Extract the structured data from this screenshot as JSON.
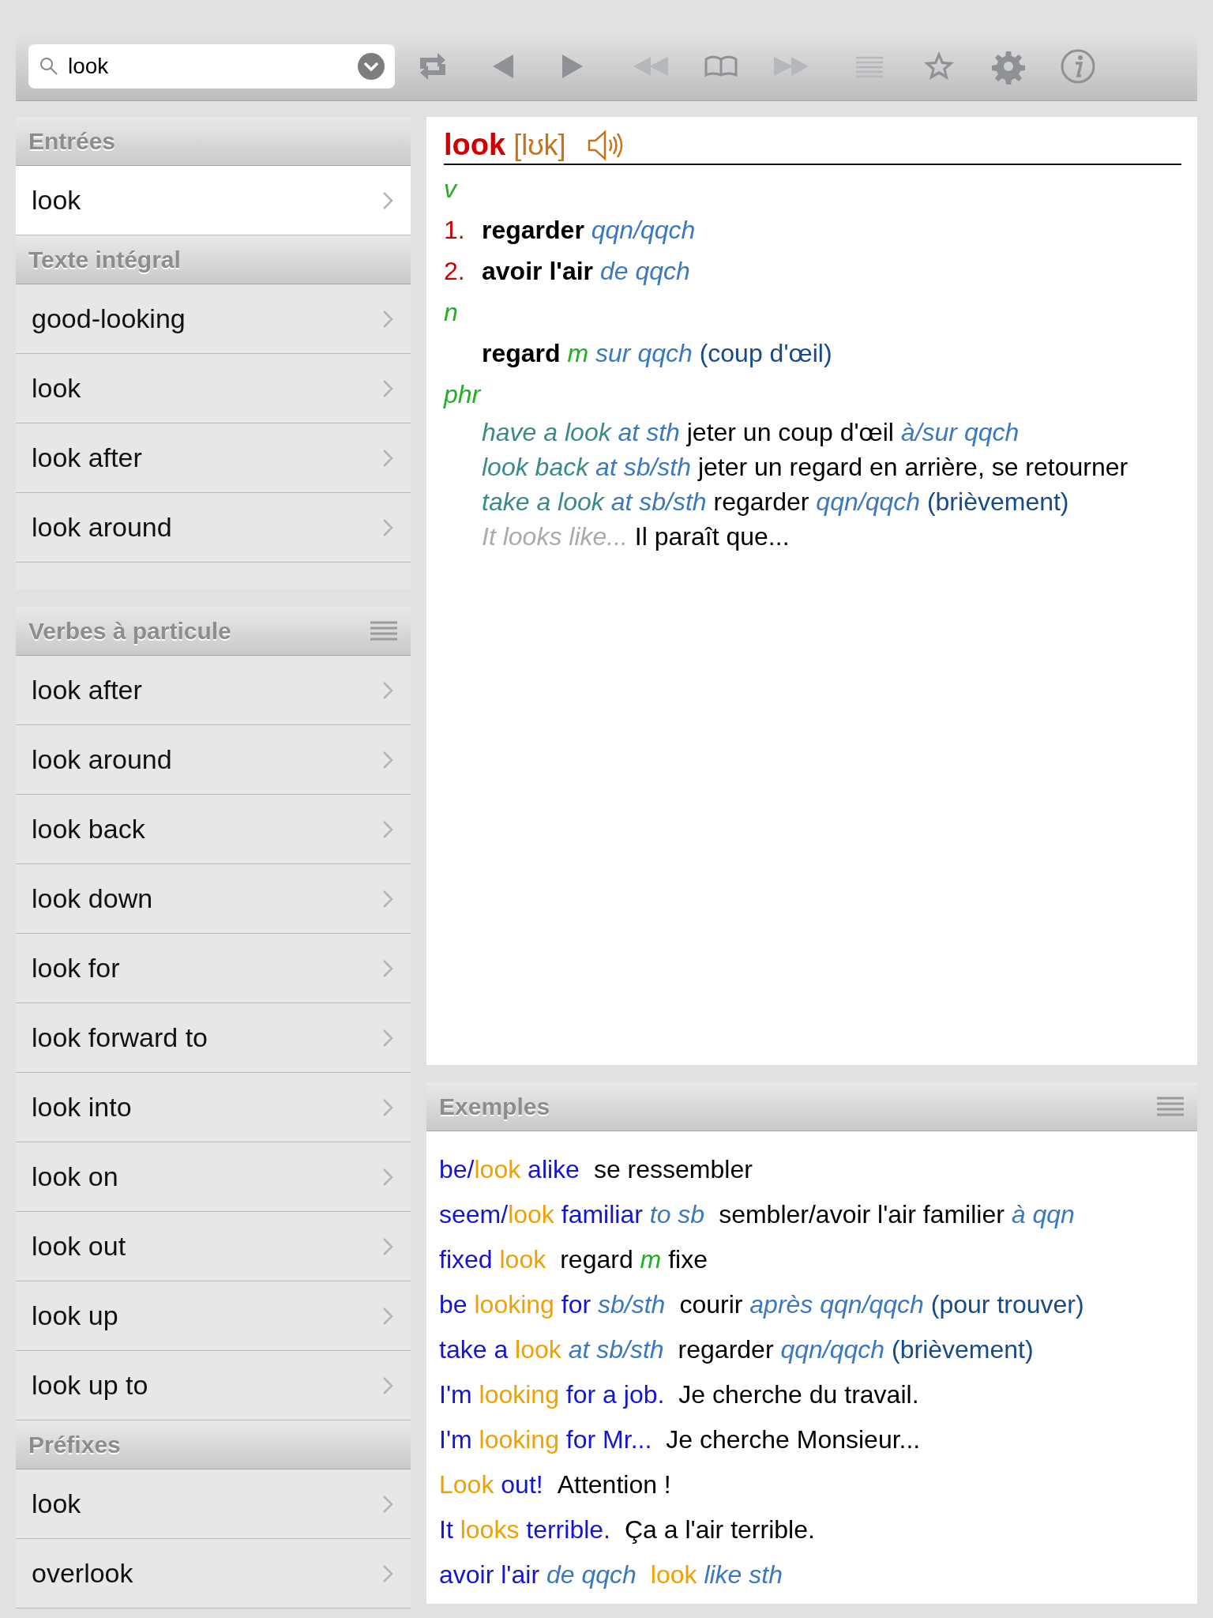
{
  "toolbar": {
    "search": {
      "value": "look"
    },
    "buttons": [
      {
        "kind": "sync",
        "disabled": false
      },
      {
        "kind": "back",
        "disabled": false
      },
      {
        "kind": "forward",
        "disabled": false
      },
      {
        "kind": "history-back",
        "disabled": true
      },
      {
        "kind": "book",
        "disabled": false
      },
      {
        "kind": "history-forward",
        "disabled": true
      },
      {
        "kind": "list",
        "disabled": true
      },
      {
        "kind": "star",
        "disabled": false
      },
      {
        "kind": "gear",
        "disabled": false
      },
      {
        "kind": "info",
        "disabled": false
      }
    ]
  },
  "sidebar": {
    "sections": [
      {
        "title": "Entrées",
        "has_menu": false,
        "clipped": false,
        "items": [
          {
            "label": "look",
            "selected": true
          }
        ]
      },
      {
        "title": "Texte intégral",
        "has_menu": false,
        "clipped": true,
        "items": [
          {
            "label": "good-looking",
            "selected": false
          },
          {
            "label": "look",
            "selected": false
          },
          {
            "label": "look after",
            "selected": false
          },
          {
            "label": "look around",
            "selected": false
          }
        ]
      },
      {
        "title": "Verbes à particule",
        "has_menu": true,
        "clipped": false,
        "items": [
          {
            "label": "look after",
            "selected": false
          },
          {
            "label": "look around",
            "selected": false
          },
          {
            "label": "look back",
            "selected": false
          },
          {
            "label": "look down",
            "selected": false
          },
          {
            "label": "look for",
            "selected": false
          },
          {
            "label": "look forward to",
            "selected": false
          },
          {
            "label": "look into",
            "selected": false
          },
          {
            "label": "look on",
            "selected": false
          },
          {
            "label": "look out",
            "selected": false
          },
          {
            "label": "look up",
            "selected": false
          },
          {
            "label": "look up to",
            "selected": false
          }
        ]
      },
      {
        "title": "Préfixes",
        "has_menu": false,
        "clipped": false,
        "items": [
          {
            "label": "look",
            "selected": false
          },
          {
            "label": "overlook",
            "selected": false
          }
        ]
      }
    ]
  },
  "entry": {
    "headword": "look",
    "phonetic": "[lʊk]",
    "lines": [
      {
        "kind": "pos",
        "text": "v"
      },
      {
        "kind": "sense",
        "num": "1.",
        "segs": [
          {
            "kind": "bold",
            "t": "regarder "
          },
          {
            "kind": "ital",
            "t": "qqn/qqch"
          }
        ]
      },
      {
        "kind": "sense",
        "num": "2.",
        "segs": [
          {
            "kind": "bold",
            "t": "avoir l'air "
          },
          {
            "kind": "ital",
            "t": "de qqch"
          }
        ]
      },
      {
        "kind": "pos",
        "text": "n"
      },
      {
        "kind": "sense",
        "segs": [
          {
            "kind": "bold",
            "t": "regard "
          },
          {
            "kind": "green",
            "t": "m "
          },
          {
            "kind": "ital",
            "t": "sur qqch "
          },
          {
            "kind": "gloss",
            "t": "(coup d'œil)"
          }
        ]
      },
      {
        "kind": "pos",
        "text": "phr"
      },
      {
        "kind": "phrase",
        "segs": [
          {
            "kind": "phrase",
            "t": "have a look "
          },
          {
            "kind": "ital",
            "t": "at sth "
          },
          {
            "kind": "plain",
            "t": "jeter un coup d'œil "
          },
          {
            "kind": "ital",
            "t": "à/sur qqch"
          }
        ]
      },
      {
        "kind": "phrase",
        "segs": [
          {
            "kind": "phrase",
            "t": "look back "
          },
          {
            "kind": "ital",
            "t": "at sb/sth "
          },
          {
            "kind": "plain",
            "t": "jeter un regard en arrière, se retourner"
          }
        ]
      },
      {
        "kind": "phrase",
        "segs": [
          {
            "kind": "phrase",
            "t": "take a look "
          },
          {
            "kind": "ital",
            "t": "at sb/sth "
          },
          {
            "kind": "plain",
            "t": "regarder "
          },
          {
            "kind": "ital",
            "t": "qqn/qqch "
          },
          {
            "kind": "gloss",
            "t": "(brièvement)"
          }
        ]
      },
      {
        "kind": "phrase",
        "segs": [
          {
            "kind": "gray",
            "t": "It looks like... "
          },
          {
            "kind": "plain",
            "t": "Il paraît que..."
          }
        ]
      }
    ]
  },
  "examples": {
    "title": "Exemples",
    "has_menu": true,
    "items": [
      {
        "en": [
          {
            "kind": "en",
            "t": "be/"
          },
          {
            "kind": "key",
            "t": "look"
          },
          {
            "kind": "en",
            "t": " alike"
          }
        ],
        "fr": [
          {
            "kind": "plain",
            "t": "se ressembler"
          }
        ]
      },
      {
        "en": [
          {
            "kind": "en",
            "t": "seem/"
          },
          {
            "kind": "key",
            "t": "look"
          },
          {
            "kind": "en",
            "t": " familiar "
          },
          {
            "kind": "ital",
            "t": "to sb"
          }
        ],
        "fr": [
          {
            "kind": "plain",
            "t": "sembler/avoir l'air familier "
          },
          {
            "kind": "ital",
            "t": "à qqn"
          }
        ]
      },
      {
        "en": [
          {
            "kind": "en",
            "t": "fixed "
          },
          {
            "kind": "key",
            "t": "look"
          }
        ],
        "fr": [
          {
            "kind": "plain",
            "t": "regard "
          },
          {
            "kind": "green",
            "t": "m "
          },
          {
            "kind": "plain",
            "t": "fixe"
          }
        ]
      },
      {
        "en": [
          {
            "kind": "en",
            "t": "be "
          },
          {
            "kind": "key",
            "t": "looking"
          },
          {
            "kind": "en",
            "t": " for "
          },
          {
            "kind": "ital",
            "t": "sb/sth"
          }
        ],
        "fr": [
          {
            "kind": "plain",
            "t": "courir "
          },
          {
            "kind": "ital",
            "t": "après qqn/qqch "
          },
          {
            "kind": "gloss",
            "t": "(pour trouver)"
          }
        ]
      },
      {
        "en": [
          {
            "kind": "en",
            "t": "take a "
          },
          {
            "kind": "key",
            "t": "look"
          },
          {
            "kind": "ital",
            "t": " at sb/sth"
          }
        ],
        "fr": [
          {
            "kind": "plain",
            "t": "regarder "
          },
          {
            "kind": "ital",
            "t": "qqn/qqch "
          },
          {
            "kind": "gloss",
            "t": "(brièvement)"
          }
        ]
      },
      {
        "en": [
          {
            "kind": "en",
            "t": "I'm "
          },
          {
            "kind": "key",
            "t": "looking"
          },
          {
            "kind": "en",
            "t": " for a job."
          }
        ],
        "fr": [
          {
            "kind": "plain",
            "t": "Je cherche du travail."
          }
        ]
      },
      {
        "en": [
          {
            "kind": "en",
            "t": "I'm "
          },
          {
            "kind": "key",
            "t": "looking"
          },
          {
            "kind": "en",
            "t": " for Mr..."
          }
        ],
        "fr": [
          {
            "kind": "plain",
            "t": "Je cherche Monsieur..."
          }
        ]
      },
      {
        "en": [
          {
            "kind": "key",
            "t": "Look"
          },
          {
            "kind": "en",
            "t": " out!"
          }
        ],
        "fr": [
          {
            "kind": "plain",
            "t": "Attention !"
          }
        ]
      },
      {
        "en": [
          {
            "kind": "en",
            "t": "It "
          },
          {
            "kind": "key",
            "t": "looks"
          },
          {
            "kind": "en",
            "t": " terrible."
          }
        ],
        "fr": [
          {
            "kind": "plain",
            "t": "Ça a l'air terrible."
          }
        ]
      },
      {
        "en": [
          {
            "kind": "en",
            "t": "avoir l'air "
          },
          {
            "kind": "ital",
            "t": "de qqch"
          }
        ],
        "fr": [
          {
            "kind": "key",
            "t": "look"
          },
          {
            "kind": "ital",
            "t": " like sth"
          }
        ]
      }
    ]
  }
}
